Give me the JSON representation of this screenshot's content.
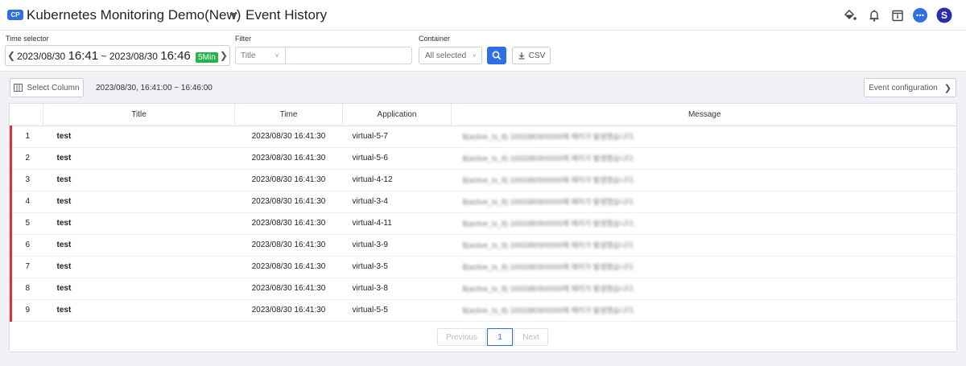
{
  "header": {
    "badge": "CP",
    "project_title": "Kubernetes Monitoring Demo(New)",
    "page_title": "Event History",
    "avatar_letter": "S",
    "icons": [
      "paint-bucket-icon",
      "bell-icon",
      "calendar-info-icon",
      "chat-icon",
      "avatar"
    ]
  },
  "filters": {
    "time_label": "Time selector",
    "time_start_date": "2023/08/30",
    "time_start_clock": "16:41",
    "time_separator": "~",
    "time_end_date": "2023/08/30",
    "time_end_clock": "16:46",
    "time_range_badge": "5Min",
    "filter_label": "Filter",
    "filter_select_value": "Title",
    "filter_input_value": "",
    "container_label": "Container",
    "container_value": "All selected",
    "csv_label": "CSV"
  },
  "toolbar": {
    "select_column_label": "Select Column",
    "range_text": "2023/08/30, 16:41:00 ~ 16:46:00",
    "event_config_label": "Event configuration"
  },
  "table": {
    "columns": [
      "",
      "Title",
      "Time",
      "Application",
      "Message"
    ],
    "rows": [
      {
        "no": "1",
        "title": "test",
        "time": "2023/08/30 16:41:30",
        "app": "virtual-5-7",
        "message": "$(active_ts_8) 1693380900000에 에러가 발생했습니다."
      },
      {
        "no": "2",
        "title": "test",
        "time": "2023/08/30 16:41:30",
        "app": "virtual-5-6",
        "message": "$(active_ts_8) 1693380900000에 에러가 발생했습니다."
      },
      {
        "no": "3",
        "title": "test",
        "time": "2023/08/30 16:41:30",
        "app": "virtual-4-12",
        "message": "$(active_ts_8) 1693380900000에 에러가 발생했습니다."
      },
      {
        "no": "4",
        "title": "test",
        "time": "2023/08/30 16:41:30",
        "app": "virtual-3-4",
        "message": "$(active_ts_8) 1693380900000에 에러가 발생했습니다."
      },
      {
        "no": "5",
        "title": "test",
        "time": "2023/08/30 16:41:30",
        "app": "virtual-4-11",
        "message": "$(active_ts_8) 1693380900000에 에러가 발생했습니다."
      },
      {
        "no": "6",
        "title": "test",
        "time": "2023/08/30 16:41:30",
        "app": "virtual-3-9",
        "message": "$(active_ts_8) 1693380900000에 에러가 발생했습니다."
      },
      {
        "no": "7",
        "title": "test",
        "time": "2023/08/30 16:41:30",
        "app": "virtual-3-5",
        "message": "$(active_ts_8) 1693380900000에 에러가 발생했습니다."
      },
      {
        "no": "8",
        "title": "test",
        "time": "2023/08/30 16:41:30",
        "app": "virtual-3-8",
        "message": "$(active_ts_8) 1693380900000에 에러가 발생했습니다."
      },
      {
        "no": "9",
        "title": "test",
        "time": "2023/08/30 16:41:30",
        "app": "virtual-5-5",
        "message": "$(active_ts_8) 1693380900000에 에러가 발생했습니다."
      }
    ]
  },
  "pagination": {
    "previous_label": "Previous",
    "current_page": "1",
    "next_label": "Next"
  },
  "colors": {
    "accent": "#2f6fe4",
    "badge_green": "#27b24a",
    "row_marker": "#d9333f"
  }
}
